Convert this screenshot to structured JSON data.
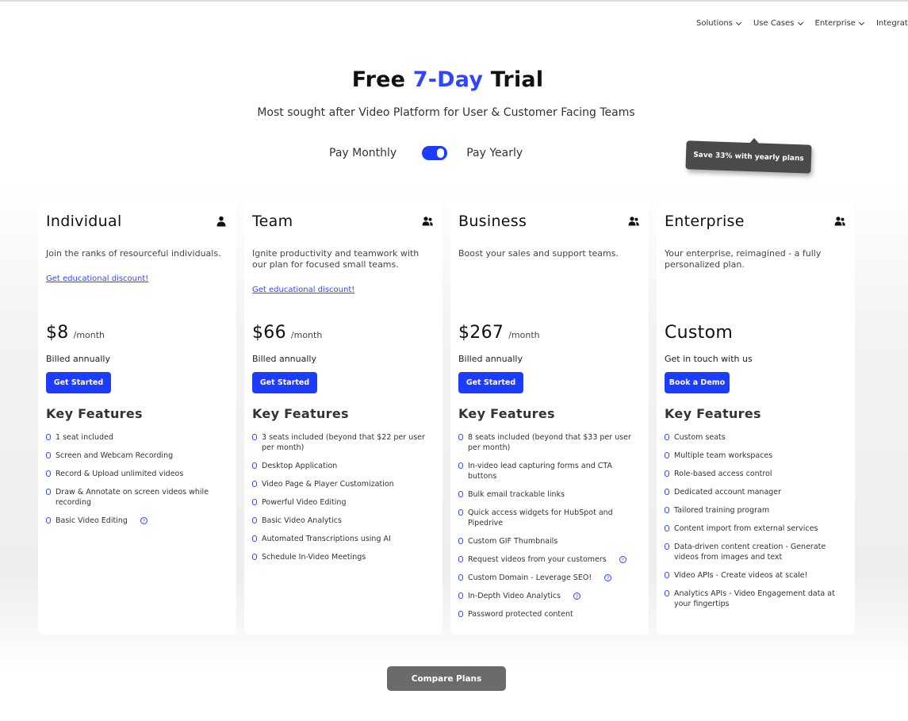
{
  "nav": {
    "items": [
      {
        "label": "Solutions"
      },
      {
        "label": "Use Cases"
      },
      {
        "label": "Enterprise"
      },
      {
        "label": "Integrations"
      }
    ]
  },
  "hero": {
    "title_prefix": "Free ",
    "title_accent": "7-Day",
    "title_suffix": " Trial",
    "subtitle": "Most sought after Video Platform for User & Customer Facing Teams"
  },
  "billing": {
    "monthly_label": "Pay Monthly",
    "yearly_label": "Pay Yearly",
    "selected": "yearly",
    "tooltip": "Save 33% with yearly plans"
  },
  "colors": {
    "accent": "#1c3cff",
    "link": "#2f45ff",
    "tooltip_bg": "#4a4a4a",
    "compare_bg": "#6b6b6b"
  },
  "plans": [
    {
      "name": "Individual",
      "icon": "user-icon",
      "description": "Join the ranks of resourceful individuals.",
      "edu_link": "Get educational discount!",
      "price": "$8",
      "period": "/month",
      "billing_note": "Billed annually",
      "cta": "Get Started",
      "features_title": "Key Features",
      "features": [
        {
          "text": "1 seat included",
          "help": false
        },
        {
          "text": "Screen and Webcam Recording",
          "help": false
        },
        {
          "text": "Record & Upload unlimited videos",
          "help": false
        },
        {
          "text": "Draw & Annotate on screen videos while recording",
          "help": false
        },
        {
          "text": "Basic Video Editing",
          "help": true
        }
      ]
    },
    {
      "name": "Team",
      "icon": "users-icon",
      "description": "Ignite productivity and teamwork with our plan for focused small teams.",
      "edu_link": "Get educational discount!",
      "price": "$66",
      "period": "/month",
      "billing_note": "Billed annually",
      "cta": "Get Started",
      "features_title": "Key Features",
      "features": [
        {
          "text": "3 seats included (beyond that $22 per user per month)",
          "help": false
        },
        {
          "text": "Desktop Application",
          "help": false
        },
        {
          "text": "Video Page & Player Customization",
          "help": false
        },
        {
          "text": "Powerful Video Editing",
          "help": false
        },
        {
          "text": "Basic Video Analytics",
          "help": false
        },
        {
          "text": "Automated Transcriptions using AI",
          "help": false
        },
        {
          "text": "Schedule In-Video Meetings",
          "help": false
        }
      ]
    },
    {
      "name": "Business",
      "icon": "users-icon",
      "description": "Boost your sales and support teams.",
      "edu_link": "",
      "price": "$267",
      "period": "/month",
      "billing_note": "Billed annually",
      "cta": "Get Started",
      "features_title": "Key Features",
      "features": [
        {
          "text": "8 seats included (beyond that $33 per user per month)",
          "help": false
        },
        {
          "text": "In-video lead capturing forms and CTA buttons",
          "help": false
        },
        {
          "text": "Bulk email trackable links",
          "help": false
        },
        {
          "text": "Quick access widgets for HubSpot and Pipedrive",
          "help": false
        },
        {
          "text": "Custom GIF Thumbnails",
          "help": false
        },
        {
          "text": "Request videos from your customers",
          "help": true
        },
        {
          "text": "Custom Domain - Leverage SEO!",
          "help": true
        },
        {
          "text": "In-Depth Video Analytics",
          "help": true
        },
        {
          "text": "Password protected content",
          "help": false
        }
      ]
    },
    {
      "name": "Enterprise",
      "icon": "users-icon",
      "description": "Your enterprise, reimagined - a fully personalized plan.",
      "edu_link": "",
      "price": "Custom",
      "period": "",
      "billing_note": "Get in touch with us",
      "cta": "Book a Demo",
      "features_title": "Key Features",
      "features": [
        {
          "text": "Custom seats",
          "help": false
        },
        {
          "text": "Multiple team workspaces",
          "help": false
        },
        {
          "text": "Role-based access control",
          "help": false
        },
        {
          "text": "Dedicated account manager",
          "help": false
        },
        {
          "text": "Tailored training program",
          "help": false
        },
        {
          "text": "Content import from external services",
          "help": false
        },
        {
          "text": "Data-driven content creation - Generate videos from images and text",
          "help": false
        },
        {
          "text": "Video APIs - Create videos at scale!",
          "help": false
        },
        {
          "text": "Analytics APIs - Video Engagement data at your fingertips",
          "help": false
        }
      ]
    }
  ],
  "compare": {
    "label": "Compare Plans"
  }
}
